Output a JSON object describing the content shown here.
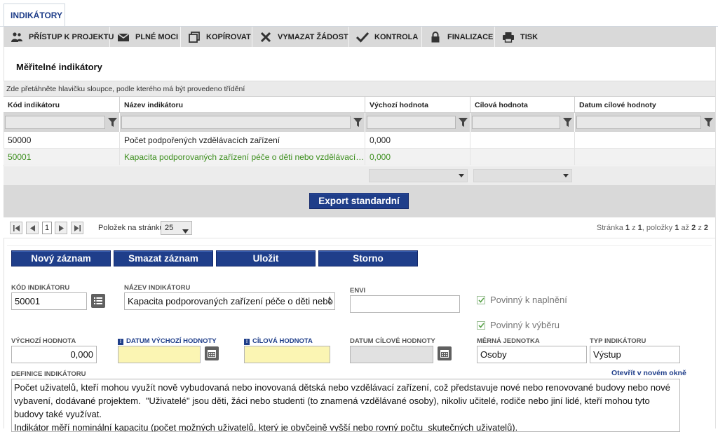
{
  "tab": {
    "label": "INDIKÁTORY"
  },
  "toolbar": {
    "items": [
      {
        "label": "PŘÍSTUP K PROJEKTU",
        "icon": "users-icon"
      },
      {
        "label": "PLNÉ MOCI",
        "icon": "envelope-icon"
      },
      {
        "label": "KOPÍROVAT",
        "icon": "copy-icon"
      },
      {
        "label": "VYMAZAT ŽÁDOST",
        "icon": "delete-x-icon"
      },
      {
        "label": "KONTROLA",
        "icon": "checkmark-icon"
      },
      {
        "label": "FINALIZACE",
        "icon": "lock-icon"
      },
      {
        "label": "TISK",
        "icon": "printer-icon"
      }
    ]
  },
  "section": {
    "title": "Měřitelné indikátory"
  },
  "grid": {
    "group_hint": "Zde přetáhněte hlavičku sloupce, podle kterého má být provedeno třídění",
    "columns": [
      "Kód indikátoru",
      "Název indikátoru",
      "Výchozí hodnota",
      "Cílová hodnota",
      "Datum cílové hodnoty"
    ],
    "rows": [
      {
        "kod": "50000",
        "nazev": "Počet podpořených vzdělávacích zařízení",
        "vychozi": "0,000",
        "cilova": "",
        "datum": ""
      },
      {
        "kod": "50001",
        "nazev": "Kapacita podporovaných zařízení péče o děti nebo vzdělávacích zařízení",
        "vychozi": "0,000",
        "cilova": "",
        "datum": ""
      }
    ]
  },
  "export": {
    "label": "Export standardní"
  },
  "pager": {
    "current_page": "1",
    "page_size_label": "Položek na stránku",
    "page_size": "25",
    "info_prefix": "Stránka",
    "page": "1",
    "of": "z",
    "pages": "1",
    "items_label": ", položky",
    "from": "1",
    "to_word": "až",
    "to": "2",
    "total": "2"
  },
  "actions": {
    "new": "Nový záznam",
    "delete": "Smazat záznam",
    "save": "Uložit",
    "cancel": "Storno"
  },
  "form": {
    "kod": {
      "label": "KÓD INDIKÁTORU",
      "value": "50001"
    },
    "nazev": {
      "label": "NÁZEV INDIKÁTORU",
      "value": "Kapacita podporovaných zařízení péče o děti nebo"
    },
    "envi": {
      "label": "ENVI",
      "value": ""
    },
    "povinny_naplneni": {
      "label": "Povinný k naplnění",
      "checked": true
    },
    "povinny_vyberu": {
      "label": "Povinný k výběru",
      "checked": true
    },
    "vychozi_hodnota": {
      "label": "VÝCHOZÍ HODNOTA",
      "value": "0,000"
    },
    "datum_vychozi": {
      "label": "DATUM VÝCHOZÍ HODNOTY",
      "value": ""
    },
    "cilova_hodnota": {
      "label": "CÍLOVÁ HODNOTA",
      "value": ""
    },
    "datum_cilove": {
      "label": "DATUM CÍLOVÉ HODNOTY",
      "value": ""
    },
    "merna_jednotka": {
      "label": "MĚRNÁ JEDNOTKA",
      "value": "Osoby"
    },
    "typ": {
      "label": "TYP INDIKÁTORU",
      "value": "Výstup"
    },
    "definice": {
      "label": "DEFINICE INDIKÁTORU",
      "open_link": "Otevřít v novém okně",
      "value": "Počet uživatelů, kteří mohou využít nově vybudovaná nebo inovovaná dětská nebo vzdělávací zařízení, což představuje nové nebo renovované budovy nebo nové vybavení, dodávané projektem.  \"Uživatelé\" jsou děti, žáci nebo studenti (to znamená vzdělávané osoby), nikoliv učitelé, rodiče nebo jiní lidé, kteří mohou tyto budovy také využívat.\nIndikátor měří nominální kapacitu (počet možných uživatelů, který je obyčejně vyšší nebo rovný počtu  skutečných uživatelů)."
    }
  },
  "colors": {
    "brand": "#1f3e8a",
    "selected_row_text": "#3d8f1e",
    "required_field": "#fbf5b3"
  }
}
